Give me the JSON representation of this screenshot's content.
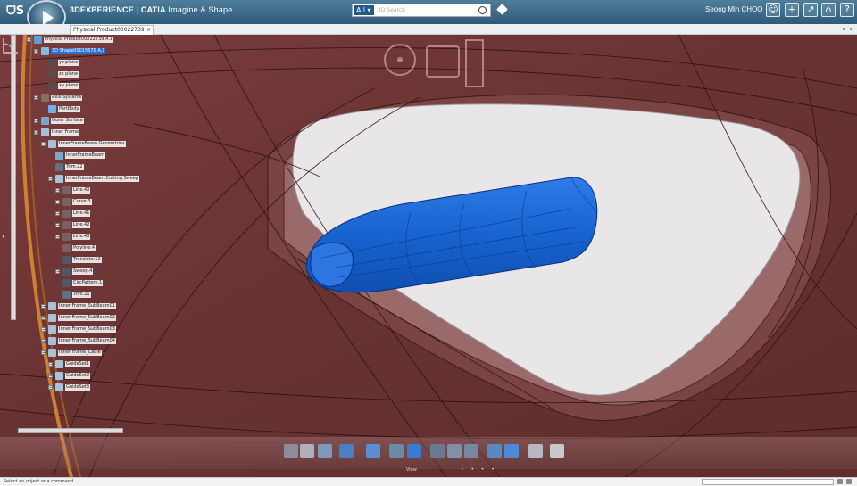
{
  "app": {
    "brand_prefix": "3DEXPERIENCE",
    "brand_sep": " | ",
    "brand_app": "CATIA",
    "brand_suffix": " Imagine & Shape",
    "user_name": "Seong Min CHOO"
  },
  "search": {
    "scope": "All",
    "placeholder": "3D Search"
  },
  "tabs": [
    {
      "label": "Physical Product00022739 A.1",
      "close": "×"
    }
  ],
  "tree": {
    "nodes": [
      {
        "label": "Physical Product00022739 A.1",
        "icon": "product-icon",
        "color": "#5aa0d8"
      },
      {
        "label": "3D Shape00015670 A.1",
        "icon": "shape-icon",
        "color": "#88b9e0",
        "selected": true
      },
      {
        "label": "yz plane",
        "icon": "plane-icon",
        "color": "#5a4a4a"
      },
      {
        "label": "zx plane",
        "icon": "plane-icon",
        "color": "#5a4a4a"
      },
      {
        "label": "xy plane",
        "icon": "plane-icon",
        "color": "#5a4a4a"
      },
      {
        "label": "Axis Systems",
        "icon": "axis-icon",
        "color": "#8a7060"
      },
      {
        "label": "PartBody",
        "icon": "body-icon",
        "color": "#6fb0e8"
      },
      {
        "label": "Outer Surface",
        "icon": "surface-icon",
        "color": "#7aa8c8"
      },
      {
        "label": "Inner Frame",
        "icon": "set-icon",
        "color": "#a8c0d8"
      },
      {
        "label": "InnerFrameBeam.Geometries",
        "icon": "set-icon",
        "color": "#a8c0d8"
      },
      {
        "label": "InnerFrameBeam",
        "icon": "surface-icon",
        "color": "#7aa8c8"
      },
      {
        "label": "Trim.22",
        "icon": "trim-icon",
        "color": "#607080"
      },
      {
        "label": "InnerFrameBeam.Cutting Sweep",
        "icon": "set-icon",
        "color": "#a8c0d8"
      },
      {
        "label": "Line.40",
        "icon": "line-icon",
        "color": "#7a6060"
      },
      {
        "label": "Curve.3",
        "icon": "curve-icon",
        "color": "#7a6060"
      },
      {
        "label": "Line.41",
        "icon": "line-icon",
        "color": "#7a6060"
      },
      {
        "label": "Line.42",
        "icon": "line-icon",
        "color": "#7a6060"
      },
      {
        "label": "Line.43",
        "icon": "line-icon",
        "color": "#7a6060"
      },
      {
        "label": "Polyline.4",
        "icon": "polyline-icon",
        "color": "#7a6060"
      },
      {
        "label": "Translate.12",
        "icon": "translate-icon",
        "color": "#556"
      },
      {
        "label": "Sweep.4",
        "icon": "sweep-icon",
        "color": "#556"
      },
      {
        "label": "CircPattern.1",
        "icon": "pattern-icon",
        "color": "#556"
      },
      {
        "label": "Trim.21",
        "icon": "trim-icon",
        "color": "#607080"
      },
      {
        "label": "Inner Frame_SubBeam01",
        "icon": "set-icon",
        "color": "#a8c0d8"
      },
      {
        "label": "Inner Frame_SubBeam02",
        "icon": "set-icon",
        "color": "#a8c0d8"
      },
      {
        "label": "Inner Frame_SubBeam03",
        "icon": "set-icon",
        "color": "#a8c0d8"
      },
      {
        "label": "Inner Frame_SubBeam04",
        "icon": "set-icon",
        "color": "#a8c0d8"
      },
      {
        "label": "Inner Frame_Cable",
        "icon": "set-icon",
        "color": "#a8c0d8"
      },
      {
        "label": "GuideSet1",
        "icon": "set-icon",
        "color": "#a8c0d8"
      },
      {
        "label": "GuideSet2",
        "icon": "set-icon",
        "color": "#a8c0d8"
      },
      {
        "label": "GuideSet3",
        "icon": "set-icon",
        "color": "#a8c0d8"
      }
    ]
  },
  "actionbar": {
    "section_label": "View",
    "dots": "• • • •"
  },
  "status": {
    "prompt": "Select an object or a command"
  },
  "colors": {
    "viewport_bg": "#6a3434",
    "shape_blue": "#1a66d6",
    "opening_fill": "#e8e6e6",
    "selection": "#2e6fd0"
  }
}
